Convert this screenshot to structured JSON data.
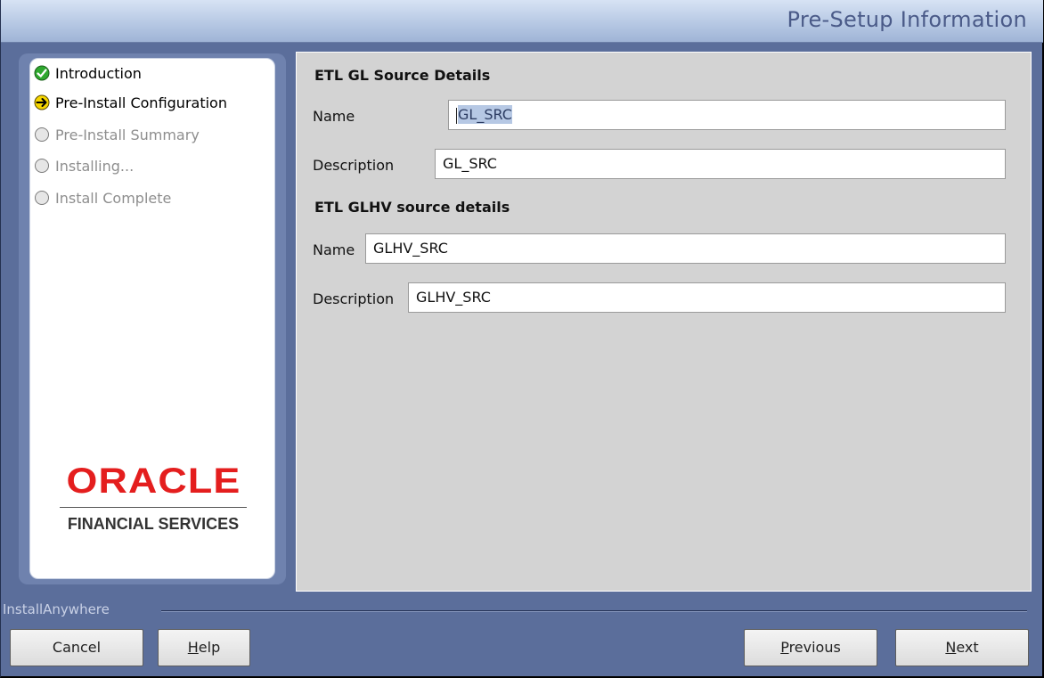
{
  "window": {
    "title": "Pre-Setup Information"
  },
  "steps": [
    {
      "label": "Introduction",
      "state": "done",
      "icon": "check-circle-icon"
    },
    {
      "label": "Pre-Install Configuration",
      "state": "current",
      "icon": "arrow-circle-icon"
    },
    {
      "label": "Pre-Install Summary",
      "state": "pending",
      "icon": "empty-circle-icon"
    },
    {
      "label": "Installing...",
      "state": "pending",
      "icon": "empty-circle-icon"
    },
    {
      "label": "Install Complete",
      "state": "pending",
      "icon": "empty-circle-icon"
    }
  ],
  "logo": {
    "brand": "ORACLE",
    "subtitle": "FINANCIAL SERVICES"
  },
  "sections": {
    "gl": {
      "heading": "ETL GL Source Details",
      "name_label": "Name",
      "name_value": "GL_SRC",
      "desc_label": "Description",
      "desc_value": "GL_SRC"
    },
    "glhv": {
      "heading": "ETL GLHV source details",
      "name_label": "Name",
      "name_value": "GLHV_SRC",
      "desc_label": "Description",
      "desc_value": "GLHV_SRC"
    }
  },
  "footer": {
    "vendor": "InstallAnywhere",
    "cancel_label": "Cancel",
    "help_label": "Help",
    "help_mnemonic": "H",
    "help_rest": "elp",
    "previous_label": "Previous",
    "previous_mnemonic": "P",
    "previous_rest": "revious",
    "next_label": "Next",
    "next_mnemonic": "N",
    "next_rest": "ext"
  },
  "colors": {
    "window_bg": "#5b6e9b",
    "content_bg": "#d3d3d3",
    "brand_red": "#e41e1e",
    "selection": "#b6c8e4",
    "done_green": "#2ea82e",
    "current_yellow": "#f5d500"
  }
}
